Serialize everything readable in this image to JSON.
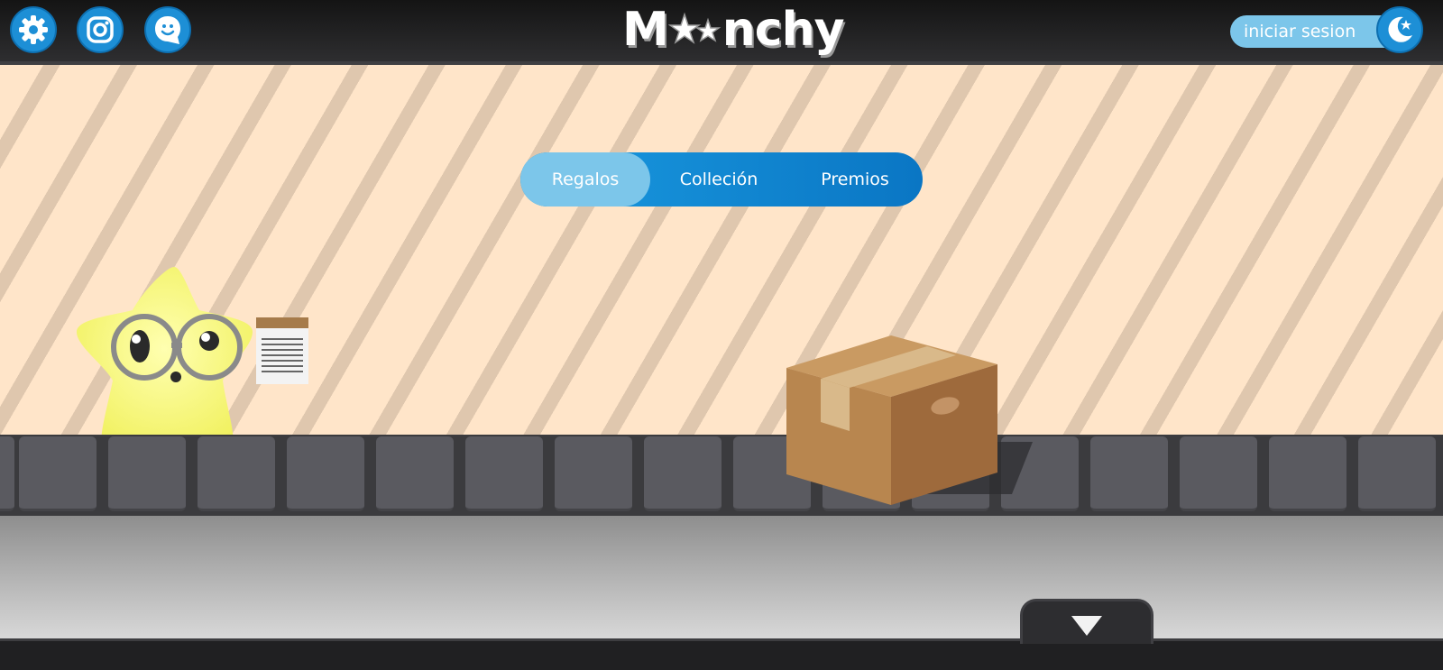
{
  "header": {
    "buttons": [
      {
        "name": "settings",
        "icon": "gear-icon"
      },
      {
        "name": "instagram",
        "icon": "instagram-icon"
      },
      {
        "name": "feedback",
        "icon": "smile-chat-icon"
      }
    ],
    "logo_text": [
      "M",
      "nchy"
    ],
    "login_label": "iniciar sesion",
    "theme_icon": "moon-icon"
  },
  "tabs": [
    {
      "label": "Regalos",
      "active": true
    },
    {
      "label": "Colleción",
      "active": false
    },
    {
      "label": "Premios",
      "active": false
    }
  ],
  "scene": {
    "mascot": "star-with-glasses",
    "held_item": "notepad-icon",
    "object": "cardboard-box"
  },
  "footer": {
    "toggle_icon": "chevron-down-icon"
  },
  "colors": {
    "accent": "#1d8fd6",
    "accent_light": "#7cc6ea",
    "wall": "#ffe5c9",
    "stripe": "#dfc7ae",
    "star": "#f4f56e",
    "box": "#b8864f"
  }
}
